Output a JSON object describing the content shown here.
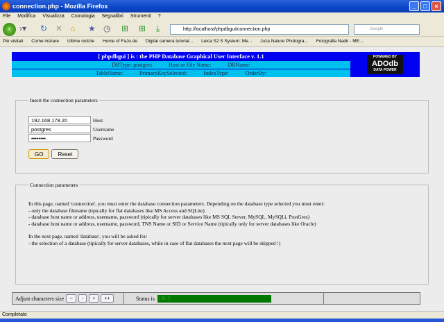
{
  "window": {
    "title": "connection.php - Mozilla Firefox"
  },
  "menu": [
    "File",
    "Modifica",
    "Visualizza",
    "Cronologia",
    "Segnalibri",
    "Strumenti",
    "?"
  ],
  "url": "http://localhost/phpdbgui/connection.php",
  "search_placeholder": "Google",
  "bookmarks": [
    "Più visitati",
    "Come iniziare",
    "Ultime notizie",
    "Home of FaJo.de",
    "Digital camera tutorial...",
    "Leica S2 S System: Me...",
    "Juza Nature Photogra...",
    "Fotografia Nadir - ME..."
  ],
  "header": {
    "title": "[ phpdbgui ] is :   the PHP Database Graphical User Interface v. 1.1",
    "row2": [
      "DBType: postgres",
      "Host or File Name:",
      "DBName:"
    ],
    "row3": [
      "TableName:",
      "PrimaryKeySelected:",
      "IndexType:",
      "OrderBy:"
    ],
    "logo_top": "POWERED BY",
    "logo_main": "ADOdb",
    "logo_sub": "DATA POWER"
  },
  "form": {
    "legend": "Insert the connection parameters",
    "host_value": "192.168.178.20",
    "host_label": "Host",
    "username_value": "postgres",
    "username_label": "Username",
    "password_value": "password",
    "password_label": "Password",
    "go": "GO",
    "reset": "Reset"
  },
  "info": {
    "legend": "Connection parameters",
    "lines": [
      "In this page, named 'connection', you must enter the database connection parameters. Depending on the database type selected you must enter:",
      "- only the database filename (tipically for flat databases like MS Access and SQLite)",
      "- database host name or address, username, password (tipically for server databases like MS SQL Server, MySQL, MySQLi, PostGres)",
      "- database host name or address, username, password, TNS Name or SID or Service Name (tipically only for server databases like Oracle)",
      "In the next page, named 'database', you will be asked for:",
      "- the selection of a database (tipically for server databases, while in case of flat databases the next page will be skipped !)"
    ]
  },
  "bottom": {
    "adjust": "Adjust characters size",
    "btns": [
      "--",
      "-",
      "+",
      "++"
    ],
    "status_label": "Status is",
    "status_value": "OK!!!"
  },
  "statusbar": "Completato"
}
